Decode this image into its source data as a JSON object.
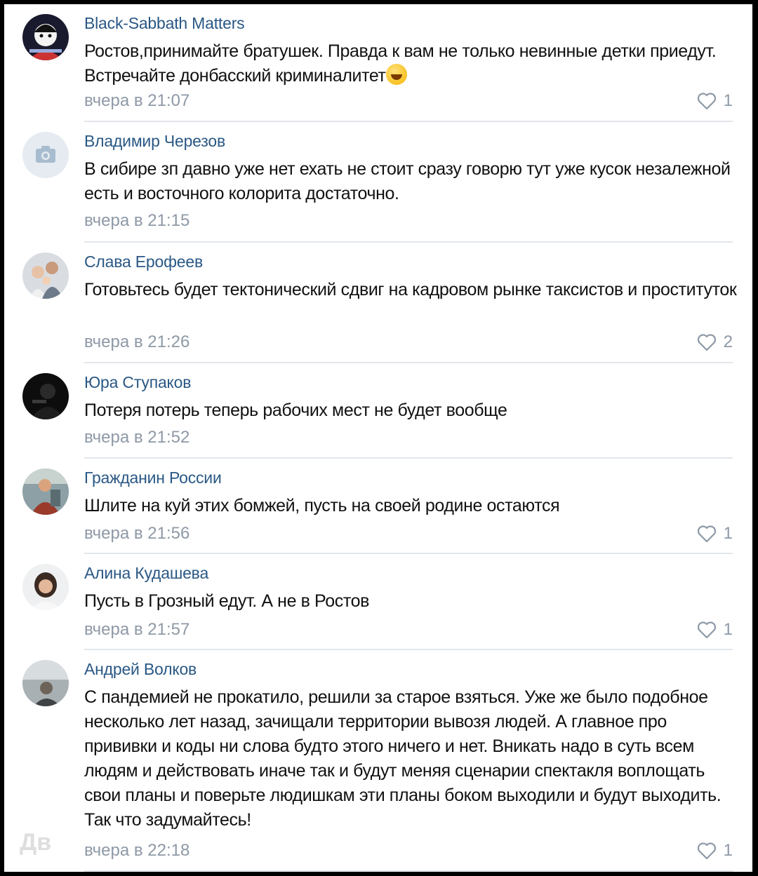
{
  "comments": [
    {
      "author": "Black-Sabbath Matters",
      "text": "Ростов,принимайте братушек. Правда к вам не только невинные детки приедут. Встречайте донбасский криминалитет",
      "emoji": "grinning-face",
      "time": "вчера в 21:07",
      "likes": "1",
      "avatar": "cartoon-avatar"
    },
    {
      "author": "Владимир Черезов",
      "text": "В сибире зп давно уже нет ехать не стоит сразу говорю тут уже кусок незалежной есть и восточного колорита достаточно.",
      "time": "вчера в 21:15",
      "avatar": "camera-placeholder"
    },
    {
      "author": "Слава Ерофеев",
      "text": "Готовьтесь будет тектонический сдвиг на кадровом рынке таксистов и проституток",
      "time": "вчера в 21:26",
      "likes": "2",
      "avatar": "family-photo"
    },
    {
      "author": "Юра Ступаков",
      "text": "Потеря потерь теперь рабочих мест не будет вообще",
      "time": "вчера в 21:52",
      "avatar": "dark-photo"
    },
    {
      "author": "Гражданин России",
      "text": "Шлите на куй этих бомжей, пусть на своей родине остаются",
      "time": "вчера в 21:56",
      "likes": "1",
      "avatar": "man-photo"
    },
    {
      "author": "Алина Кудашева",
      "text": "Пусть в Грозный едут. А не в Ростов",
      "time": "вчера в 21:57",
      "likes": "1",
      "avatar": "woman-photo"
    },
    {
      "author": "Андрей Волков",
      "text": "С пандемией не прокатило, решили за старое взяться. Уже же было подобное несколько лет назад, зачищали территории вывозя людей. А главное про прививки и коды ни слова будто этого ничего и нет. Вникать надо в суть всем людям и действовать иначе так и будут меняя сценарии спектакля воплощать свои планы и поверьте людишкам эти планы боком выходили и будут выходить. Так что задумайтесь!",
      "time": "вчера в 22:18",
      "likes": "1",
      "avatar": "outdoor-photo"
    }
  ],
  "watermark": "Дв",
  "colors": {
    "author": "#2a5885",
    "meta": "#8e99a6",
    "text": "#111111",
    "divider": "#e2e6eb"
  }
}
